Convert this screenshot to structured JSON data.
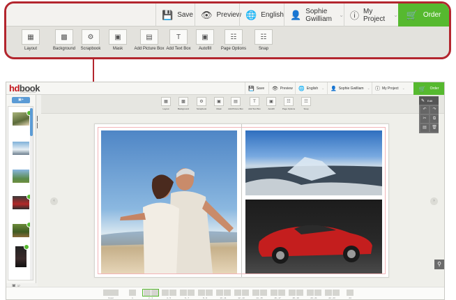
{
  "toolbar": {
    "save_label": "Save",
    "preview_label": "Preview",
    "language": "English",
    "user_name": "Sophie Gwilliam",
    "project_name": "My Project",
    "order_label": "Order"
  },
  "tools": [
    {
      "label": "Layout",
      "icon": "layout-icon"
    },
    {
      "label": "Background",
      "icon": "background-icon"
    },
    {
      "label": "Scrapbook",
      "icon": "scrapbook-icon"
    },
    {
      "label": "Mask",
      "icon": "mask-icon"
    },
    {
      "label": "Add Picture Box",
      "icon": "add-picture-box-icon"
    },
    {
      "label": "Add Text Box",
      "icon": "add-text-box-icon"
    },
    {
      "label": "Autofill",
      "icon": "autofill-icon"
    },
    {
      "label": "Page Options",
      "icon": "page-options-icon"
    },
    {
      "label": "Snap",
      "icon": "snap-icon"
    }
  ],
  "logo": {
    "brand_hd": "hd",
    "brand_book": "book",
    "tagline": "powered by pixel"
  },
  "sidebar": {
    "photo_count": "37"
  },
  "edit_panel": {
    "label": "Edit"
  },
  "colors": {
    "accent_red": "#c4161c",
    "order_green": "#56b92f",
    "sidebar_blue": "#5b9bd5"
  },
  "pages": [
    "Cover",
    "1",
    "2 - 3",
    "4 - 5",
    "6 - 7",
    "8 - 9",
    "10 - 11",
    "12 - 13",
    "14 - 15",
    "16 - 17",
    "18 - 19",
    "20 - 21",
    "22 - 23",
    "24"
  ],
  "selected_page": "2 - 3"
}
